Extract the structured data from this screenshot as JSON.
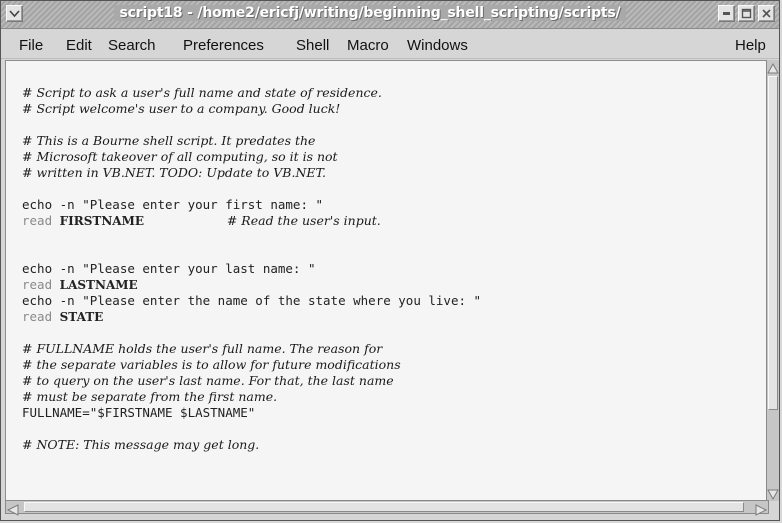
{
  "window": {
    "title": "script18 - /home2/ericfj/writing/beginning_shell_scripting/scripts/"
  },
  "menubar": {
    "items": [
      {
        "label": "File"
      },
      {
        "label": "Edit"
      },
      {
        "label": "Search"
      },
      {
        "label": "Preferences"
      },
      {
        "label": "Shell"
      },
      {
        "label": "Macro"
      },
      {
        "label": "Windows"
      }
    ],
    "help_label": "Help"
  },
  "editor": {
    "lines": [
      [],
      [
        {
          "t": "# Script to ask a user's full name and state of residence.",
          "c": "comment"
        }
      ],
      [
        {
          "t": "# Script welcome's user to a company. Good luck!",
          "c": "comment"
        }
      ],
      [],
      [
        {
          "t": "# This is a Bourne shell script. It predates the",
          "c": "comment"
        }
      ],
      [
        {
          "t": "# Microsoft takeover of all computing, so it is not",
          "c": "comment"
        }
      ],
      [
        {
          "t": "# written in VB.NET. TODO: Update to VB.NET.",
          "c": "comment"
        }
      ],
      [],
      [
        {
          "t": "echo -n \"Please enter your first name: \"",
          "c": "plain"
        }
      ],
      [
        {
          "t": "read",
          "c": "kw"
        },
        {
          "t": " ",
          "c": "plain"
        },
        {
          "t": "FIRSTNAME",
          "c": "ident"
        },
        {
          "t": "           ",
          "c": "plain"
        },
        {
          "t": "# Read the user's input.",
          "c": "comment"
        }
      ],
      [],
      [],
      [
        {
          "t": "echo -n \"Please enter your last name: \"",
          "c": "plain"
        }
      ],
      [
        {
          "t": "read",
          "c": "kw"
        },
        {
          "t": " ",
          "c": "plain"
        },
        {
          "t": "LASTNAME",
          "c": "ident"
        }
      ],
      [
        {
          "t": "echo -n \"Please enter the name of the state where you live: \"",
          "c": "plain"
        }
      ],
      [
        {
          "t": "read",
          "c": "kw"
        },
        {
          "t": " ",
          "c": "plain"
        },
        {
          "t": "STATE",
          "c": "ident"
        }
      ],
      [],
      [
        {
          "t": "# FULLNAME holds the user's full name. The reason for",
          "c": "comment"
        }
      ],
      [
        {
          "t": "# the separate variables is to allow for future modifications",
          "c": "comment"
        }
      ],
      [
        {
          "t": "# to query on the user's last name. For that, the last name",
          "c": "comment"
        }
      ],
      [
        {
          "t": "# must be separate from the first name.",
          "c": "comment"
        }
      ],
      [
        {
          "t": "FULLNAME=\"$FIRSTNAME $LASTNAME\"",
          "c": "plain"
        }
      ],
      [],
      [
        {
          "t": "# NOTE: This message may get long.",
          "c": "comment"
        }
      ]
    ]
  },
  "colors": {
    "editor_background": "#f5f5f5",
    "keyword": "#8a8a8a",
    "titlebar_text": "#ffffff"
  }
}
